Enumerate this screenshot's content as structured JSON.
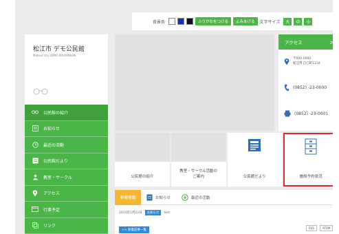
{
  "toolbar": {
    "bg_color_label": "背景色",
    "furigana_label": "ふりがなをつける",
    "readaloud_label": "よみあげる",
    "font_size_label": "文字サイズ",
    "size_large": "大",
    "size_medium": "中",
    "size_small": "小"
  },
  "site": {
    "title": "松江市 デモ公民館",
    "subtitle": "Matsue city DEMO KOUMINKAN"
  },
  "sidebar": {
    "items": [
      {
        "label": "公民館の紹介",
        "icon": "glasses-icon"
      },
      {
        "label": "お知らせ",
        "icon": "notice-icon"
      },
      {
        "label": "最近の活動",
        "icon": "clock-icon"
      },
      {
        "label": "公民館だより",
        "icon": "newsletter-icon"
      },
      {
        "label": "教室・サークル",
        "icon": "circle-icon"
      },
      {
        "label": "アクセス",
        "icon": "map-pin-icon"
      },
      {
        "label": "行事予定",
        "icon": "calendar-icon"
      },
      {
        "label": "リンク",
        "icon": "link-icon"
      }
    ]
  },
  "access": {
    "title": "アクセス",
    "arrow": ">",
    "postal": "〒000-0000",
    "address": "松江市 〇〇町1234",
    "tel": "(0852) -23-0000",
    "fax": "(0852) -23-0001"
  },
  "tiles": [
    {
      "label": "公民館の紹介"
    },
    {
      "label": "教室・サークル活動の\nご案内"
    },
    {
      "label": "公民館だより"
    },
    {
      "label": "施設予約状況"
    }
  ],
  "news": {
    "tabs": [
      "新着情報",
      "お知らせ",
      "最近の活動"
    ],
    "date": "2013年1月22日",
    "badge": "お知らせ",
    "item": "test",
    "list_button": ">> 新着記事一覧",
    "rss1": "RSS",
    "rss2": "ATOM"
  },
  "colors": {
    "green": "#4cb548",
    "orange": "#f5b731",
    "blue": "#2e8ad8",
    "selection_red": "#d92b2b"
  }
}
